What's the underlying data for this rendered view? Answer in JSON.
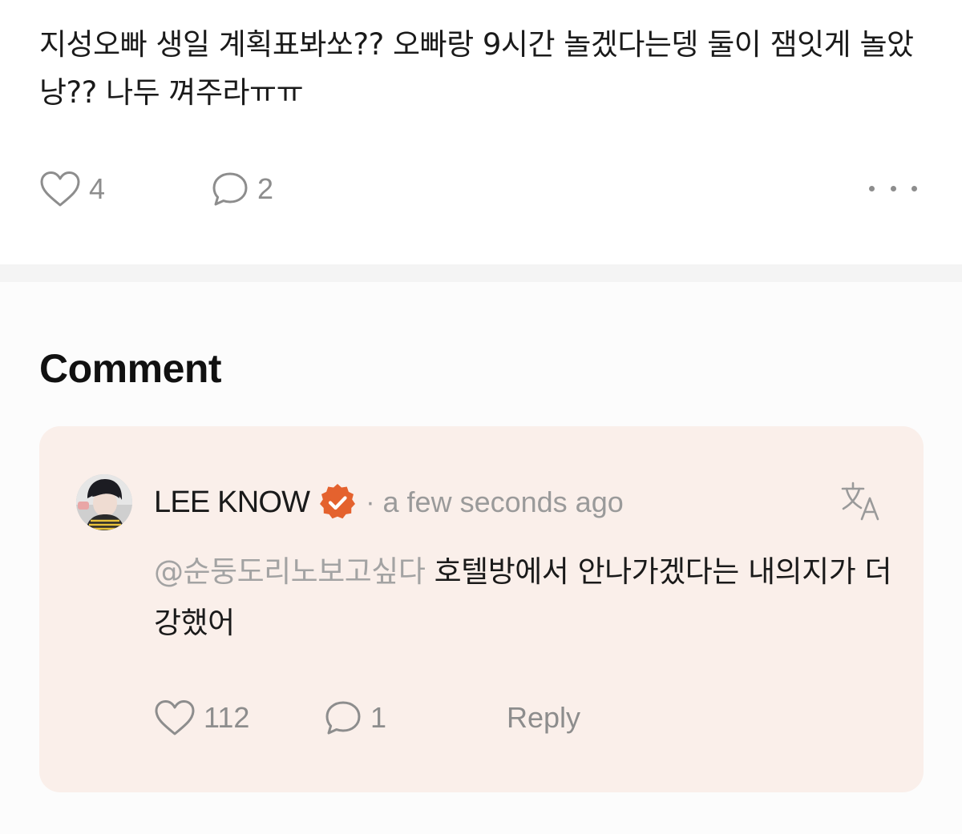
{
  "post": {
    "body": "지성오빠 생일 계획표봐쏘?? 오빠랑 9시간 놀겠다는뎅 둘이 잼잇게 놀았낭?? 나두 껴주라ㅠㅠ",
    "like_count": "4",
    "comment_count": "2"
  },
  "comments_section": {
    "title": "Comment"
  },
  "comment": {
    "author": "LEE KNOW",
    "separator": "·",
    "timestamp": "a few seconds ago",
    "mention": "@순둥도리노보고싶다",
    "text": "호텔방에서 안나가겠다는 내의지가 더강했어",
    "like_count": "112",
    "reply_count": "1",
    "reply_label": "Reply"
  },
  "colors": {
    "badge": "#e4622e",
    "card_background": "#faefea",
    "muted_text": "#8d8d8d"
  },
  "icons": [
    "heart-icon",
    "comment-bubble-icon",
    "more-dots-icon",
    "verified-badge-icon",
    "translate-icon"
  ]
}
